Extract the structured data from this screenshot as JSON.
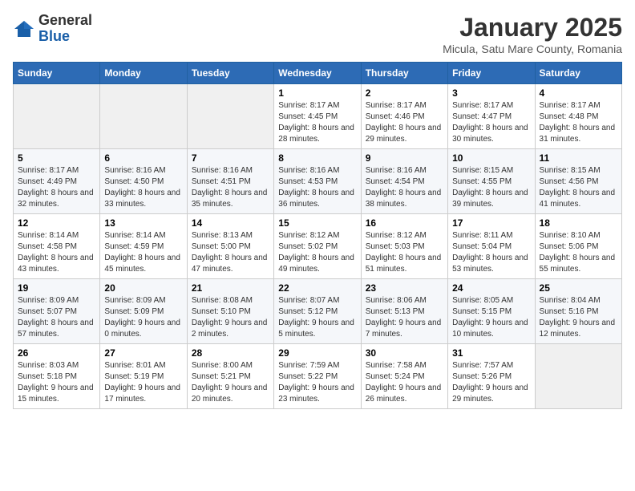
{
  "header": {
    "logo_general": "General",
    "logo_blue": "Blue",
    "title": "January 2025",
    "subtitle": "Micula, Satu Mare County, Romania"
  },
  "weekdays": [
    "Sunday",
    "Monday",
    "Tuesday",
    "Wednesday",
    "Thursday",
    "Friday",
    "Saturday"
  ],
  "weeks": [
    [
      {
        "day": "",
        "empty": true
      },
      {
        "day": "",
        "empty": true
      },
      {
        "day": "",
        "empty": true
      },
      {
        "day": "1",
        "sunrise": "8:17 AM",
        "sunset": "4:45 PM",
        "daylight": "8 hours and 28 minutes."
      },
      {
        "day": "2",
        "sunrise": "8:17 AM",
        "sunset": "4:46 PM",
        "daylight": "8 hours and 29 minutes."
      },
      {
        "day": "3",
        "sunrise": "8:17 AM",
        "sunset": "4:47 PM",
        "daylight": "8 hours and 30 minutes."
      },
      {
        "day": "4",
        "sunrise": "8:17 AM",
        "sunset": "4:48 PM",
        "daylight": "8 hours and 31 minutes."
      }
    ],
    [
      {
        "day": "5",
        "sunrise": "8:17 AM",
        "sunset": "4:49 PM",
        "daylight": "8 hours and 32 minutes."
      },
      {
        "day": "6",
        "sunrise": "8:16 AM",
        "sunset": "4:50 PM",
        "daylight": "8 hours and 33 minutes."
      },
      {
        "day": "7",
        "sunrise": "8:16 AM",
        "sunset": "4:51 PM",
        "daylight": "8 hours and 35 minutes."
      },
      {
        "day": "8",
        "sunrise": "8:16 AM",
        "sunset": "4:53 PM",
        "daylight": "8 hours and 36 minutes."
      },
      {
        "day": "9",
        "sunrise": "8:16 AM",
        "sunset": "4:54 PM",
        "daylight": "8 hours and 38 minutes."
      },
      {
        "day": "10",
        "sunrise": "8:15 AM",
        "sunset": "4:55 PM",
        "daylight": "8 hours and 39 minutes."
      },
      {
        "day": "11",
        "sunrise": "8:15 AM",
        "sunset": "4:56 PM",
        "daylight": "8 hours and 41 minutes."
      }
    ],
    [
      {
        "day": "12",
        "sunrise": "8:14 AM",
        "sunset": "4:58 PM",
        "daylight": "8 hours and 43 minutes."
      },
      {
        "day": "13",
        "sunrise": "8:14 AM",
        "sunset": "4:59 PM",
        "daylight": "8 hours and 45 minutes."
      },
      {
        "day": "14",
        "sunrise": "8:13 AM",
        "sunset": "5:00 PM",
        "daylight": "8 hours and 47 minutes."
      },
      {
        "day": "15",
        "sunrise": "8:12 AM",
        "sunset": "5:02 PM",
        "daylight": "8 hours and 49 minutes."
      },
      {
        "day": "16",
        "sunrise": "8:12 AM",
        "sunset": "5:03 PM",
        "daylight": "8 hours and 51 minutes."
      },
      {
        "day": "17",
        "sunrise": "8:11 AM",
        "sunset": "5:04 PM",
        "daylight": "8 hours and 53 minutes."
      },
      {
        "day": "18",
        "sunrise": "8:10 AM",
        "sunset": "5:06 PM",
        "daylight": "8 hours and 55 minutes."
      }
    ],
    [
      {
        "day": "19",
        "sunrise": "8:09 AM",
        "sunset": "5:07 PM",
        "daylight": "8 hours and 57 minutes."
      },
      {
        "day": "20",
        "sunrise": "8:09 AM",
        "sunset": "5:09 PM",
        "daylight": "9 hours and 0 minutes."
      },
      {
        "day": "21",
        "sunrise": "8:08 AM",
        "sunset": "5:10 PM",
        "daylight": "9 hours and 2 minutes."
      },
      {
        "day": "22",
        "sunrise": "8:07 AM",
        "sunset": "5:12 PM",
        "daylight": "9 hours and 5 minutes."
      },
      {
        "day": "23",
        "sunrise": "8:06 AM",
        "sunset": "5:13 PM",
        "daylight": "9 hours and 7 minutes."
      },
      {
        "day": "24",
        "sunrise": "8:05 AM",
        "sunset": "5:15 PM",
        "daylight": "9 hours and 10 minutes."
      },
      {
        "day": "25",
        "sunrise": "8:04 AM",
        "sunset": "5:16 PM",
        "daylight": "9 hours and 12 minutes."
      }
    ],
    [
      {
        "day": "26",
        "sunrise": "8:03 AM",
        "sunset": "5:18 PM",
        "daylight": "9 hours and 15 minutes."
      },
      {
        "day": "27",
        "sunrise": "8:01 AM",
        "sunset": "5:19 PM",
        "daylight": "9 hours and 17 minutes."
      },
      {
        "day": "28",
        "sunrise": "8:00 AM",
        "sunset": "5:21 PM",
        "daylight": "9 hours and 20 minutes."
      },
      {
        "day": "29",
        "sunrise": "7:59 AM",
        "sunset": "5:22 PM",
        "daylight": "9 hours and 23 minutes."
      },
      {
        "day": "30",
        "sunrise": "7:58 AM",
        "sunset": "5:24 PM",
        "daylight": "9 hours and 26 minutes."
      },
      {
        "day": "31",
        "sunrise": "7:57 AM",
        "sunset": "5:26 PM",
        "daylight": "9 hours and 29 minutes."
      },
      {
        "day": "",
        "empty": true
      }
    ]
  ],
  "labels": {
    "sunrise": "Sunrise:",
    "sunset": "Sunset:",
    "daylight": "Daylight:"
  }
}
